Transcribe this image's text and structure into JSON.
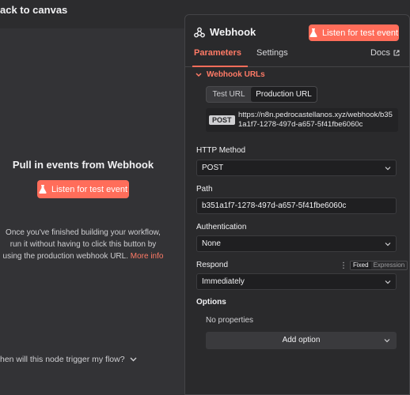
{
  "topbar": {
    "back_label": "ack to canvas"
  },
  "left": {
    "title": "Pull in events from Webhook",
    "listen_button": "Listen for test event",
    "description": "Once you've finished building your workflow, run it without having to click this button by using the production webhook URL.",
    "more_info": "More info",
    "when_question": "hen will this node trigger my flow?"
  },
  "panel": {
    "title": "Webhook",
    "listen_button": "Listen for test event",
    "tabs": {
      "parameters": "Parameters",
      "settings": "Settings",
      "docs": "Docs"
    },
    "webhook_urls": {
      "label": "Webhook URLs",
      "test_url": "Test URL",
      "production_url": "Production URL",
      "method_badge": "POST",
      "url": "https://n8n.pedrocastellanos.xyz/webhook/b351a1f7-1278-497d-a657-5f41fbe6060c"
    },
    "http_method": {
      "label": "HTTP Method",
      "value": "POST"
    },
    "path": {
      "label": "Path",
      "value": "b351a1f7-1278-497d-a657-5f41fbe6060c"
    },
    "authentication": {
      "label": "Authentication",
      "value": "None"
    },
    "respond": {
      "label": "Respond",
      "value": "Immediately",
      "fixed": "Fixed",
      "expression": "Expression"
    },
    "options": {
      "label": "Options",
      "empty": "No properties",
      "add_option": "Add option"
    }
  },
  "colors": {
    "accent": "#ff6d5a",
    "panel_bg": "#2a2a2c",
    "canvas_bg": "#333336"
  }
}
